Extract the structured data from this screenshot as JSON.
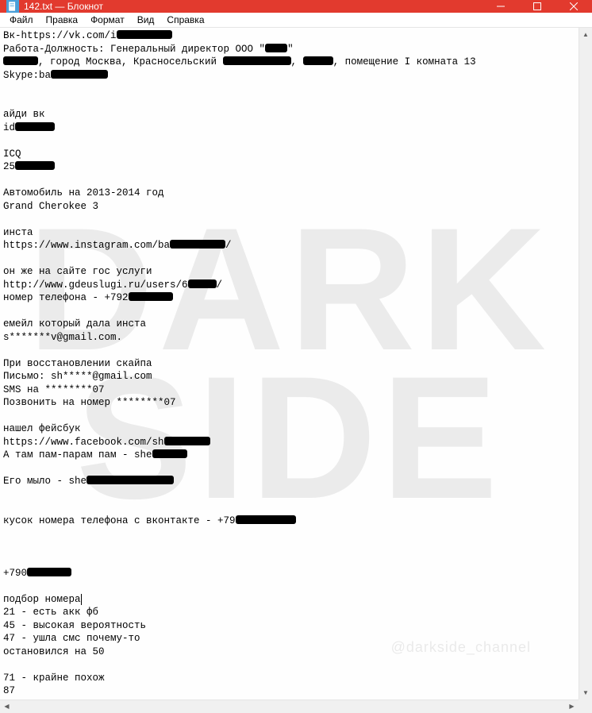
{
  "window": {
    "title": "142.txt — Блокнот"
  },
  "menu": {
    "file": "Файл",
    "edit": "Правка",
    "format": "Формат",
    "view": "Вид",
    "help": "Справка"
  },
  "content": {
    "line1_a": "Вк-https://vk.com/i",
    "line2_a": "Работа-Должность: Генеральный директор ООО \"",
    "line2_b": "\"",
    "line3_a": "",
    "line3_b": ", город Москва, Красносельский ",
    "line3_c": ", ",
    "line3_d": ", помещение I комната 13",
    "line4_a": "Skype:ba",
    "line7": "айди вк",
    "line8_a": "id",
    "line10": "ICQ",
    "line11_a": "25",
    "line13": "Автомобиль на 2013-2014 год",
    "line14": "Grand Cherokee 3",
    "line16": "инста",
    "line17_a": "https://www.instagram.com/ba",
    "line17_b": "/",
    "line19": "он же на сайте гос услуги",
    "line20_a": "http://www.gdeuslugi.ru/users/6",
    "line20_b": "/",
    "line21_a": "номер телефона - +792",
    "line23": "емейл который дала инста",
    "line24": "s*******v@gmail.com.",
    "line26": "При восстановлении скайпа",
    "line27": "Письмо: sh*****@gmail.com",
    "line28": "SMS на ********07",
    "line29": "Позвонить на номер ********07",
    "line31": "нашел фейсбук",
    "line32_a": "https://www.facebook.com/sh",
    "line33_a": "А там пам-парам пам - she",
    "line35_a": "Его мыло - she",
    "line38_a": "кусок номера телефона с вконтакте - +79",
    "line42_a": "+790",
    "line44": "подбор номера",
    "line45": "21 - есть акк фб",
    "line46": "45 - высокая вероятность",
    "line47": "47 - ушла смс почему-то",
    "line48": "остановился на 50",
    "line50": "71 - крайне похож",
    "line51": "87"
  },
  "watermark": {
    "line1": "DARK",
    "line2": "SIDE",
    "channel": "@darkside_channel"
  }
}
